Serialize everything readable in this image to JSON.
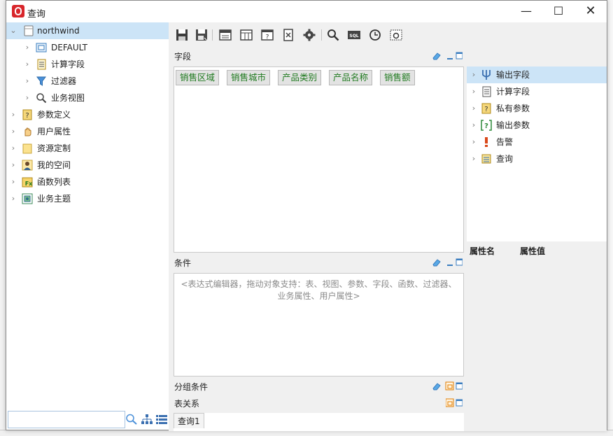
{
  "window": {
    "title": "查询"
  },
  "left_tree": [
    {
      "label": "northwind",
      "expanded": true,
      "selected": true
    },
    {
      "label": "DEFAULT"
    },
    {
      "label": "计算字段"
    },
    {
      "label": "过滤器"
    },
    {
      "label": "业务视图"
    },
    {
      "label": "参数定义"
    },
    {
      "label": "用户属性"
    },
    {
      "label": "资源定制"
    },
    {
      "label": "我的空间"
    },
    {
      "label": "函数列表"
    },
    {
      "label": "业务主题"
    }
  ],
  "sections": {
    "fields": "字段",
    "conditions": "条件",
    "group_conditions": "分组条件",
    "table_relations": "表关系"
  },
  "field_chips": [
    "销售区域",
    "销售城市",
    "产品类别",
    "产品名称",
    "销售额"
  ],
  "condition_placeholder": "<表达式编辑器，拖动对象支持：表、视图、参数、字段、函数、过滤器、业务属性、用户属性>",
  "tabs": [
    "查询1"
  ],
  "right_tree": [
    {
      "label": "输出字段",
      "selected": true
    },
    {
      "label": "计算字段"
    },
    {
      "label": "私有参数"
    },
    {
      "label": "输出参数"
    },
    {
      "label": "告警"
    },
    {
      "label": "查询"
    }
  ],
  "property_columns": [
    "属性名",
    "属性值"
  ],
  "colors": {
    "selection": "#cce4f7",
    "chip_text": "#1f7a1f",
    "accent_orange": "#e07b00"
  }
}
